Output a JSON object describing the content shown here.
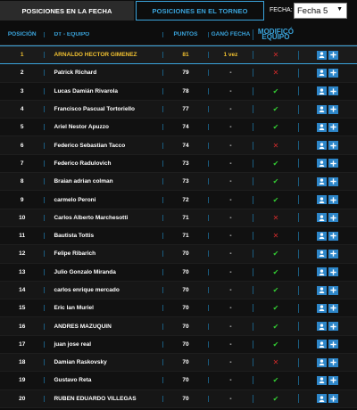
{
  "tabs": {
    "active_label": "POSICIONES EN LA FECHA",
    "inactive_label": "POSICIONES EN EL TORNEO"
  },
  "fecha": {
    "label": "FECHA:",
    "selected": "Fecha 5"
  },
  "columns": {
    "pos": "POSICIÓN",
    "team": "DT - EQUIPO",
    "pts": "PUNTOS",
    "gano": "GANÓ FECHA",
    "mod": "MODIFICÓ EQUIPO"
  },
  "colors": {
    "accent": "#3aa4dc",
    "highlight": "#f0c030",
    "check": "#33cc33",
    "cross": "#d22b2b",
    "button": "#2d86c9"
  },
  "rows": [
    {
      "pos": "1",
      "name": "ARNALDO HECTOR GIMENEZ",
      "pts": "81",
      "gano": "1 vez",
      "mod": "✕",
      "mod_ok": false
    },
    {
      "pos": "2",
      "name": "Patrick Richard",
      "pts": "79",
      "gano": "-",
      "mod": "✕",
      "mod_ok": false
    },
    {
      "pos": "3",
      "name": "Lucas Damián Rivarola",
      "pts": "78",
      "gano": "-",
      "mod": "✔",
      "mod_ok": true
    },
    {
      "pos": "4",
      "name": "Francisco Pascual Tortoriello",
      "pts": "77",
      "gano": "-",
      "mod": "✔",
      "mod_ok": true
    },
    {
      "pos": "5",
      "name": "Ariel Nestor Apuzzo",
      "pts": "74",
      "gano": "-",
      "mod": "✔",
      "mod_ok": true
    },
    {
      "pos": "6",
      "name": "Federico Sebastian Tacco",
      "pts": "74",
      "gano": "-",
      "mod": "✕",
      "mod_ok": false
    },
    {
      "pos": "7",
      "name": "Federico Radulovich",
      "pts": "73",
      "gano": "-",
      "mod": "✔",
      "mod_ok": true
    },
    {
      "pos": "8",
      "name": "Braian adrian colman",
      "pts": "73",
      "gano": "-",
      "mod": "✔",
      "mod_ok": true
    },
    {
      "pos": "9",
      "name": "carmelo Peroni",
      "pts": "72",
      "gano": "-",
      "mod": "✔",
      "mod_ok": true
    },
    {
      "pos": "10",
      "name": "Carlos Alberto Marchesotti",
      "pts": "71",
      "gano": "-",
      "mod": "✕",
      "mod_ok": false
    },
    {
      "pos": "11",
      "name": "Bautista Tottis",
      "pts": "71",
      "gano": "-",
      "mod": "✕",
      "mod_ok": false
    },
    {
      "pos": "12",
      "name": "Felipe Ribarich",
      "pts": "70",
      "gano": "-",
      "mod": "✔",
      "mod_ok": true
    },
    {
      "pos": "13",
      "name": "Julio Gonzalo Miranda",
      "pts": "70",
      "gano": "-",
      "mod": "✔",
      "mod_ok": true
    },
    {
      "pos": "14",
      "name": "carlos enrique mercado",
      "pts": "70",
      "gano": "-",
      "mod": "✔",
      "mod_ok": true
    },
    {
      "pos": "15",
      "name": "Eric Ian Muriel",
      "pts": "70",
      "gano": "-",
      "mod": "✔",
      "mod_ok": true
    },
    {
      "pos": "16",
      "name": "ANDRES MAZUQUIN",
      "pts": "70",
      "gano": "-",
      "mod": "✔",
      "mod_ok": true
    },
    {
      "pos": "17",
      "name": "juan jose real",
      "pts": "70",
      "gano": "-",
      "mod": "✔",
      "mod_ok": true
    },
    {
      "pos": "18",
      "name": "Damian Raskovsky",
      "pts": "70",
      "gano": "-",
      "mod": "✕",
      "mod_ok": false
    },
    {
      "pos": "19",
      "name": "Gustavo Reta",
      "pts": "70",
      "gano": "-",
      "mod": "✔",
      "mod_ok": true
    },
    {
      "pos": "20",
      "name": "RUBEN EDUARDO VILLEGAS",
      "pts": "70",
      "gano": "-",
      "mod": "✔",
      "mod_ok": true
    }
  ]
}
